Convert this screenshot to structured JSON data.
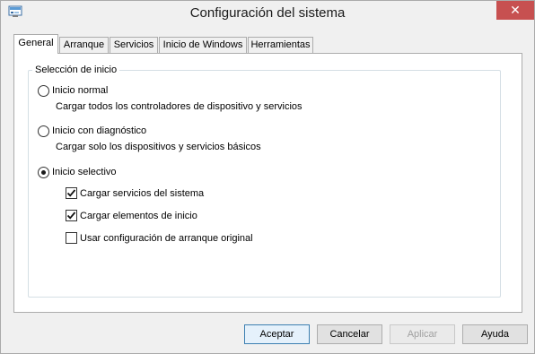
{
  "window": {
    "title": "Configuración del sistema",
    "close_glyph": "✕"
  },
  "tabs": [
    {
      "label": "General",
      "active": true
    },
    {
      "label": "Arranque",
      "active": false
    },
    {
      "label": "Servicios",
      "active": false
    },
    {
      "label": "Inicio de Windows",
      "active": false
    },
    {
      "label": "Herramientas",
      "active": false
    }
  ],
  "startup_selection": {
    "group_label": "Selección de inicio",
    "options": [
      {
        "label": "Inicio normal",
        "description": "Cargar todos los controladores de dispositivo y servicios",
        "selected": false
      },
      {
        "label": "Inicio con diagnóstico",
        "description": "Cargar solo los dispositivos y servicios básicos",
        "selected": false
      },
      {
        "label": "Inicio selectivo",
        "selected": true
      }
    ],
    "selective_checkboxes": [
      {
        "label": "Cargar servicios del sistema",
        "checked": true
      },
      {
        "label": "Cargar elementos de inicio",
        "checked": true
      },
      {
        "label": "Usar configuración de arranque original",
        "checked": false
      }
    ]
  },
  "buttons": {
    "accept": "Aceptar",
    "cancel": "Cancelar",
    "apply": "Aplicar",
    "help": "Ayuda"
  },
  "colors": {
    "close_button": "#c75050",
    "default_button_border": "#3c7fb1"
  }
}
